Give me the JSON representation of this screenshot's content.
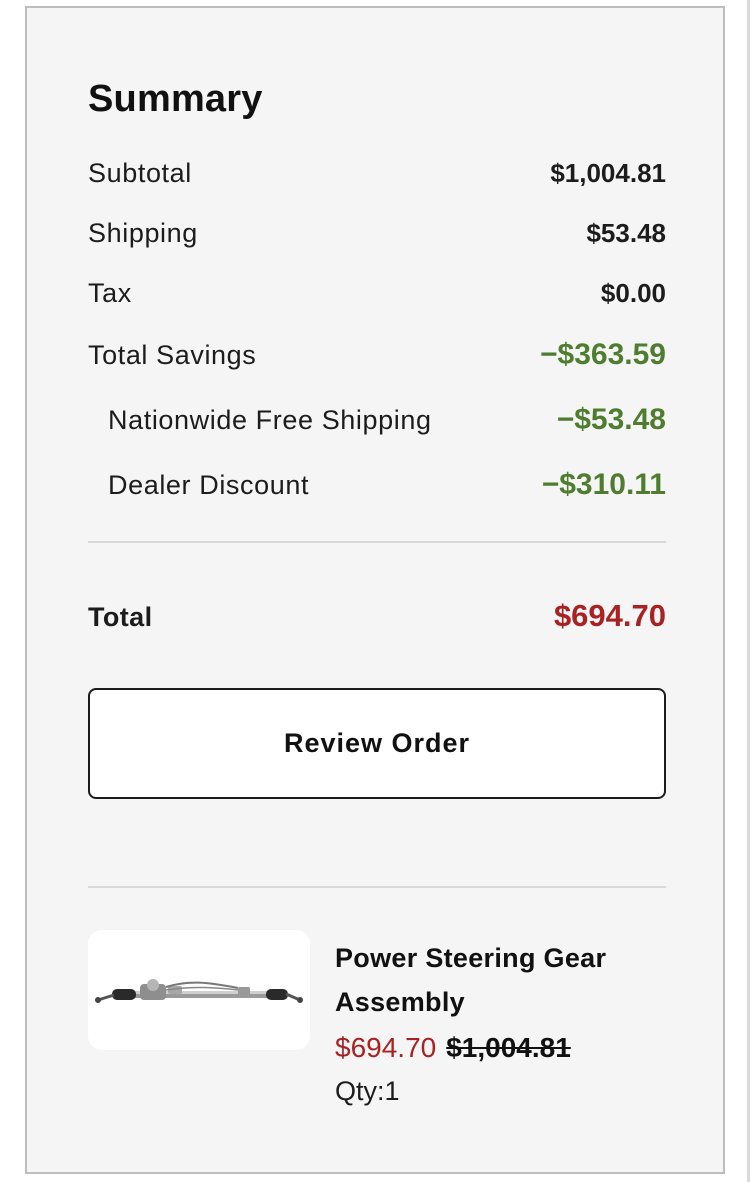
{
  "summary": {
    "title": "Summary",
    "rows": {
      "subtotal": {
        "label": "Subtotal",
        "value": "$1,004.81"
      },
      "shipping": {
        "label": "Shipping",
        "value": "$53.48"
      },
      "tax": {
        "label": "Tax",
        "value": "$0.00"
      },
      "total_savings": {
        "label": "Total Savings",
        "value": "−$363.59"
      },
      "free_shipping": {
        "label": "Nationwide Free Shipping",
        "value": "−$53.48"
      },
      "dealer_discount": {
        "label": "Dealer Discount",
        "value": "−$310.11"
      }
    },
    "total": {
      "label": "Total",
      "value": "$694.70"
    },
    "review_button_label": "Review Order"
  },
  "product": {
    "image_icon": "steering-rack-icon",
    "name": "Power Steering Gear Assembly",
    "sale_price": "$694.70",
    "original_price": "$1,004.81",
    "qty": "Qty:1"
  },
  "colors": {
    "savings_green": "#4f7d2f",
    "price_red": "#a82224",
    "panel_bg": "#f5f5f5"
  }
}
